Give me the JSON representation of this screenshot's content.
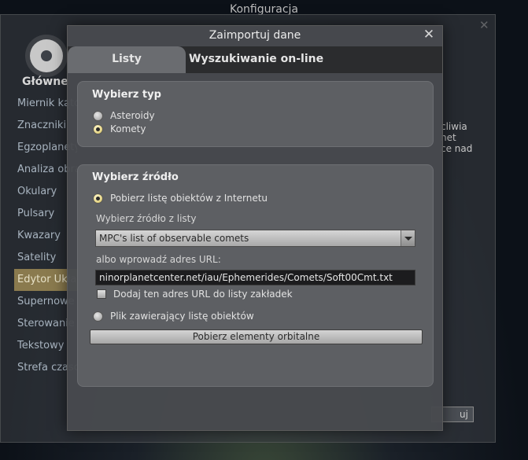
{
  "background_window": {
    "title": "Konfiguracja",
    "section_label": "Główne",
    "sidebar_items": [
      {
        "label": "Miernik kątów",
        "selected": false
      },
      {
        "label": "Znaczniki",
        "selected": false
      },
      {
        "label": "Egzoplanety",
        "selected": false
      },
      {
        "label": "Analiza obrazu",
        "selected": false
      },
      {
        "label": "Okulary",
        "selected": false
      },
      {
        "label": "Pulsary",
        "selected": false
      },
      {
        "label": "Kwazary",
        "selected": false
      },
      {
        "label": "Satelity",
        "selected": false
      },
      {
        "label": "Edytor Układu",
        "selected": true
      },
      {
        "label": "Supernowe",
        "selected": false
      },
      {
        "label": "Sterowanie",
        "selected": false
      },
      {
        "label": "Tekstowy",
        "selected": false
      },
      {
        "label": "Strefa czasowa",
        "selected": false
      }
    ],
    "side_text": "cliwia\nnet\nce nad",
    "button_label": "uj"
  },
  "dialog": {
    "title": "Zaimportuj dane",
    "tabs": [
      {
        "label": "Listy",
        "active": true
      },
      {
        "label": "Wyszukiwanie on-line",
        "active": false
      }
    ],
    "type_group": {
      "title": "Wybierz typ",
      "options": [
        {
          "label": "Asteroidy",
          "checked": false
        },
        {
          "label": "Komety",
          "checked": true
        }
      ]
    },
    "source_group": {
      "title": "Wybierz źródło",
      "internet_option": {
        "label": "Pobierz listę obiektów z Internetu",
        "checked": true
      },
      "list_label": "Wybierz źródło z listy",
      "list_selected": "MPC's list of observable comets",
      "url_label": "albo wprowadź adres URL:",
      "url_value": "ninorplanetcenter.net/iau/Ephemerides/Comets/Soft00Cmt.txt",
      "bookmark_checkbox": {
        "label": "Dodaj ten adres URL do listy zakładek",
        "checked": false
      },
      "file_option": {
        "label": "Plik zawierający listę obiektów",
        "checked": false
      },
      "fetch_button": "Pobierz elementy orbitalne"
    }
  }
}
